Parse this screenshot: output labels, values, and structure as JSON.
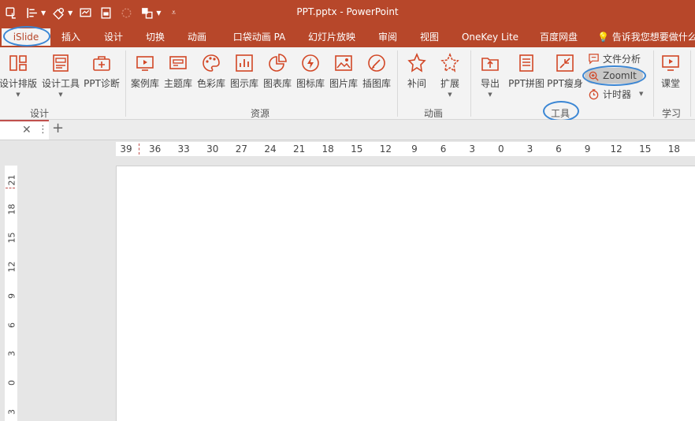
{
  "window": {
    "title": "PPT.pptx - PowerPoint"
  },
  "quick_access": {
    "icons": [
      "touch-mode-icon",
      "align-icon",
      "shapes-icon",
      "slideshow-icon",
      "new-slide-icon",
      "redo-icon",
      "arrange-icon",
      "customize-icon"
    ]
  },
  "tabs": [
    {
      "label": "iSlide"
    },
    {
      "label": "插入"
    },
    {
      "label": "设计"
    },
    {
      "label": "切换"
    },
    {
      "label": "动画"
    },
    {
      "label": "口袋动画 PA"
    },
    {
      "label": "幻灯片放映"
    },
    {
      "label": "审阅"
    },
    {
      "label": "视图"
    },
    {
      "label": "OneKey Lite"
    },
    {
      "label": "百度网盘"
    },
    {
      "label": "告诉我您想要做什么"
    }
  ],
  "ribbon": {
    "design": {
      "group_label": "设计",
      "buttons": [
        {
          "label": "设计排版",
          "has_menu": true
        },
        {
          "label": "设计工具",
          "has_menu": true
        },
        {
          "label": "PPT诊断",
          "has_menu": false
        }
      ]
    },
    "resources": {
      "group_label": "资源",
      "buttons": [
        {
          "label": "案例库"
        },
        {
          "label": "主题库"
        },
        {
          "label": "色彩库"
        },
        {
          "label": "图示库"
        },
        {
          "label": "图表库"
        },
        {
          "label": "图标库"
        },
        {
          "label": "图片库"
        },
        {
          "label": "插图库"
        }
      ]
    },
    "animation": {
      "group_label": "动画",
      "buttons": [
        {
          "label": "补间",
          "has_menu": false
        },
        {
          "label": "扩展",
          "has_menu": true
        }
      ]
    },
    "tools": {
      "group_label": "工具",
      "buttons": [
        {
          "label": "导出",
          "has_menu": true
        },
        {
          "label": "PPT拼图",
          "has_menu": false
        },
        {
          "label": "PPT瘦身",
          "has_menu": false
        }
      ],
      "small_buttons": [
        {
          "label": "文件分析"
        },
        {
          "label": "ZoomIt"
        },
        {
          "label": "计时器"
        }
      ]
    },
    "learn": {
      "group_label": "学习",
      "buttons": [
        {
          "label": "课堂"
        }
      ]
    }
  },
  "document_tab": {
    "close_glyph": "✕",
    "menu_glyph": "⋮",
    "add_glyph": "+"
  },
  "horizontal_ruler": [
    "39",
    "36",
    "33",
    "30",
    "27",
    "24",
    "21",
    "18",
    "15",
    "12",
    "9",
    "6",
    "3",
    "0",
    "3",
    "6",
    "9",
    "12",
    "15",
    "18"
  ],
  "vertical_ruler": [
    "21",
    "18",
    "15",
    "12",
    "9",
    "6",
    "3",
    "0",
    "3"
  ],
  "colors": {
    "accent": "#b7472a",
    "icon": "#d24726",
    "highlight_circle": "#3a86d4",
    "ribbon_bg": "#f3f3f3"
  }
}
